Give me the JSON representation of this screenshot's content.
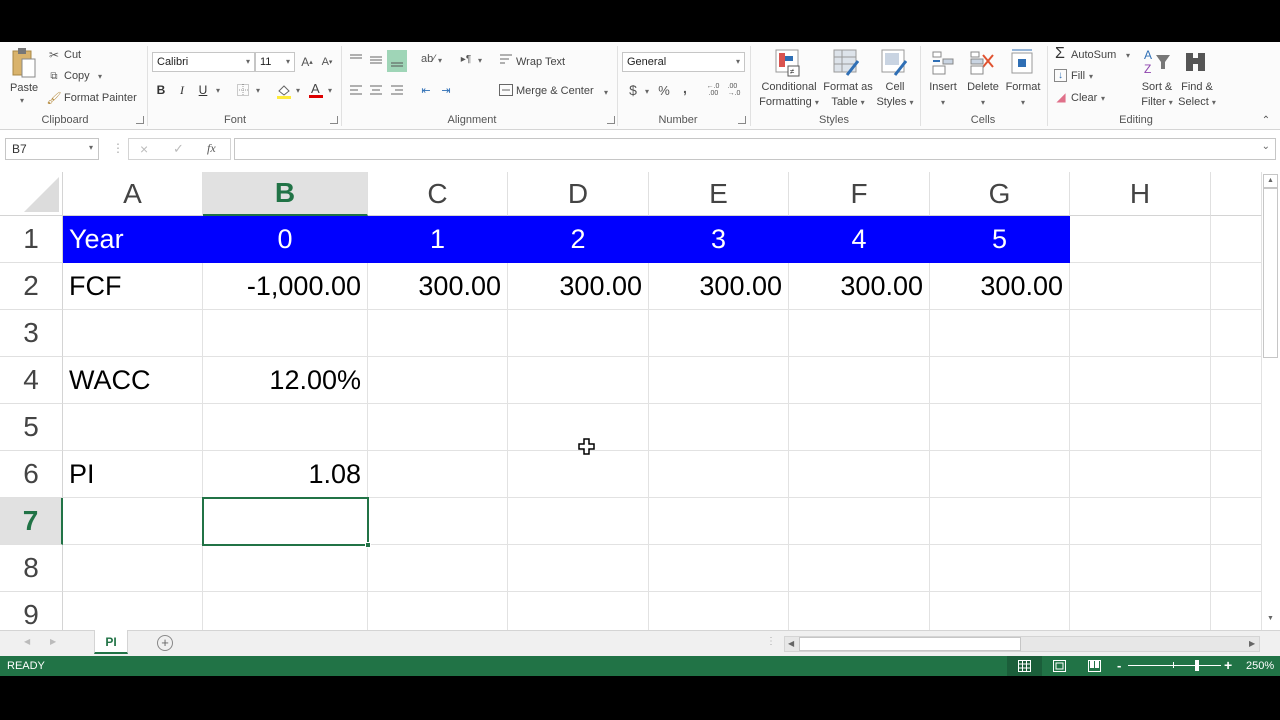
{
  "ribbon": {
    "clipboard": {
      "paste": "Paste",
      "cut": "Cut",
      "copy": "Copy",
      "format_painter": "Format Painter",
      "label": "Clipboard"
    },
    "font": {
      "name": "Calibri",
      "size": "11",
      "bold": "B",
      "italic": "I",
      "underline": "U",
      "label": "Font",
      "grow": "A",
      "shrink": "A"
    },
    "alignment": {
      "wrap_text": "Wrap Text",
      "merge_center": "Merge & Center",
      "label": "Alignment"
    },
    "number": {
      "format": "General",
      "currency": "$",
      "percent": "%",
      "comma": ",",
      "inc_dec": "←.0\n.00",
      "dec_dec": ".00\n→.0",
      "label": "Number"
    },
    "styles": {
      "conditional": "Conditional",
      "conditional2": "Formatting",
      "format_as": "Format as",
      "table": "Table",
      "cell": "Cell",
      "cell_styles": "Styles",
      "label": "Styles"
    },
    "cells": {
      "insert": "Insert",
      "delete": "Delete",
      "format": "Format",
      "label": "Cells"
    },
    "editing": {
      "autosum": "AutoSum",
      "fill": "Fill",
      "clear": "Clear",
      "sort": "Sort &",
      "filter": "Filter",
      "find": "Find &",
      "select": "Select",
      "label": "Editing"
    }
  },
  "formula_bar": {
    "name_box": "B7",
    "fx": "fx",
    "value": ""
  },
  "sheet": {
    "columns": [
      "A",
      "B",
      "C",
      "D",
      "E",
      "F",
      "G",
      "H",
      ""
    ],
    "selected_column": "B",
    "rows": [
      "1",
      "2",
      "3",
      "4",
      "5",
      "6",
      "7",
      "8",
      "9"
    ],
    "selected_row": "7",
    "selected_cell": "B7",
    "header_fill": "#0000ff",
    "cells": {
      "A1": "Year",
      "B1": "0",
      "C1": "1",
      "D1": "2",
      "E1": "3",
      "F1": "4",
      "G1": "5",
      "A2": "FCF",
      "B2": "-1,000.00",
      "C2": "300.00",
      "D2": "300.00",
      "E2": "300.00",
      "F2": "300.00",
      "G2": "300.00",
      "A4": "WACC",
      "B4": "12.00%",
      "A6": "PI",
      "B6": "1.08"
    }
  },
  "tabs": {
    "sheets": [
      "PI"
    ],
    "active": "PI"
  },
  "status": {
    "mode": "READY",
    "zoom": "250%",
    "zoom_level_percent": 250,
    "accent": "#217346"
  }
}
